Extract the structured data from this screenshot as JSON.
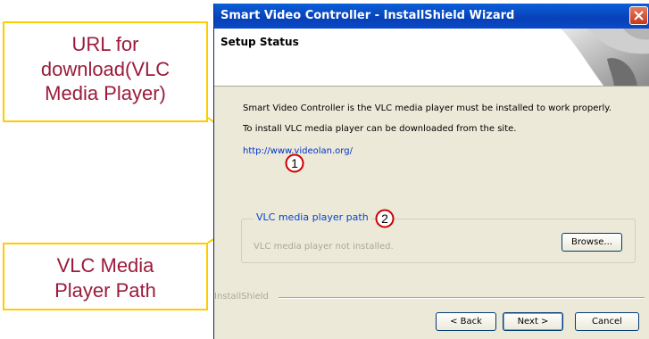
{
  "window": {
    "title": "Smart Video Controller - InstallShield Wizard",
    "heading": "Setup Status"
  },
  "body": {
    "line1": "Smart Video Controller is the VLC media player must be installed to work properly.",
    "line2": "To install VLC media player can be downloaded from the site.",
    "link": "http://www.videolan.org/",
    "group_label": "VLC media player path",
    "status": "VLC media player not installed.",
    "browse_label": "Browse...",
    "installshield": "InstallShield"
  },
  "buttons": {
    "back": "< Back",
    "next": "Next >",
    "cancel": "Cancel"
  },
  "markers": [
    "1",
    "2"
  ],
  "annotations": {
    "url_callout": [
      "URL for",
      "download(VLC",
      "Media Player)"
    ],
    "path_callout": [
      "VLC Media",
      "Player Path"
    ]
  },
  "colors": {
    "titlebar": "#0a4ac8",
    "callout_border": "#ffcc00",
    "callout_text": "#9b1b3c",
    "link": "#0033cc",
    "marker_ring": "#cc0000"
  }
}
